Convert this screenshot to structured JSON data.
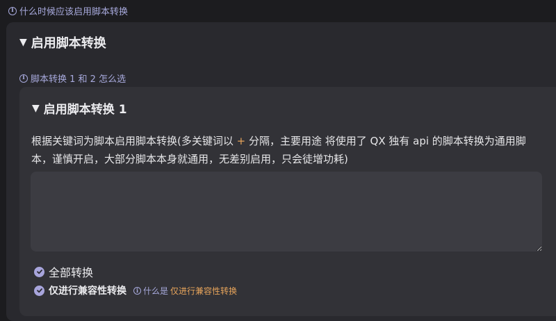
{
  "top_help": {
    "text": "什么时候应该启用脚本转换"
  },
  "section": {
    "title": "启用脚本转换",
    "help": "脚本转换 1 和 2 怎么选",
    "inner": {
      "title": "启用脚本转换 1",
      "desc_before_plus": "根据关键词为脚本启用脚本转换(多关键词以",
      "plus_symbol": "+",
      "desc_after_plus": "分隔，主要用途 将使用了 QX 独有 api 的脚本转换为通用脚本，谨慎开启，大部分脚本本身就通用，无差别启用，只会徒增功耗)",
      "textarea_value": "",
      "options": [
        {
          "label": "全部转换",
          "checked": true
        },
        {
          "label": "仅进行兼容性转换",
          "checked": true
        }
      ],
      "option_help_question": "什么是",
      "option_help_link": "仅进行兼容性转换"
    }
  },
  "colors": {
    "background": "#1c1c1f",
    "card_outer": "#29292e",
    "card_inner": "#323237",
    "help_link": "#a7a9dc",
    "accent_orange": "#e7a45b",
    "check": "#a8a5dc"
  }
}
